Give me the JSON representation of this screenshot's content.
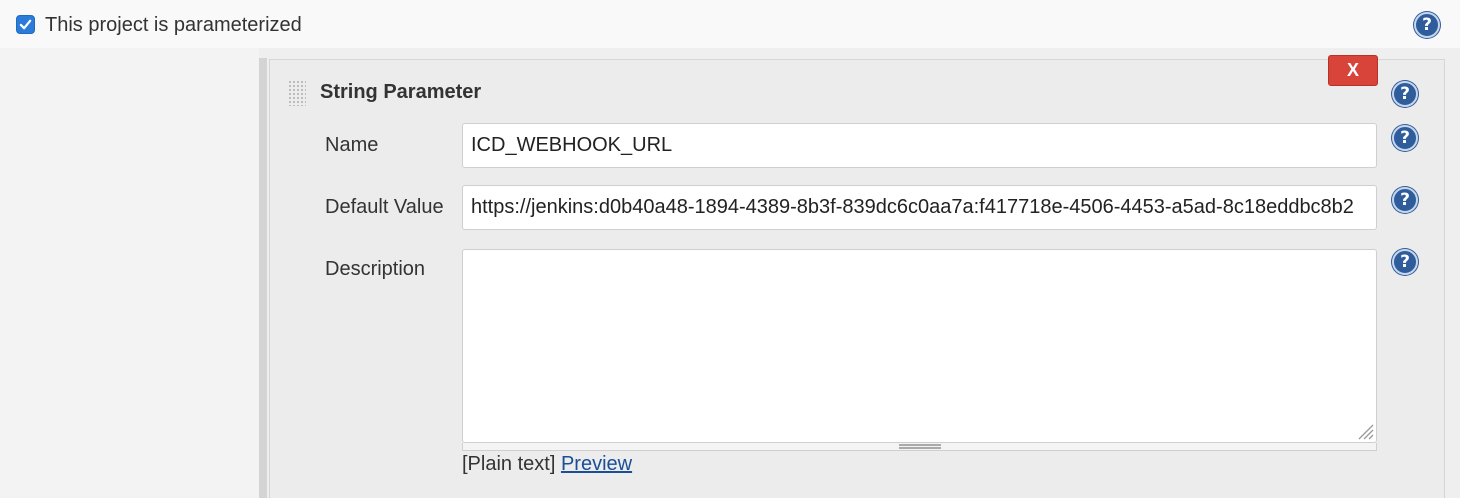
{
  "parameterized": {
    "checked": true,
    "label": "This project is parameterized"
  },
  "parameter": {
    "title": "String Parameter",
    "delete_label": "X",
    "fields": {
      "name": {
        "label": "Name",
        "value": "ICD_WEBHOOK_URL"
      },
      "default_value": {
        "label": "Default Value",
        "value": "https://jenkins:d0b40a48-1894-4389-8b3f-839dc6c0aa7a:f417718e-4506-4453-a5ad-8c18eddbc8b2"
      },
      "description": {
        "label": "Description",
        "value": ""
      }
    },
    "format": {
      "current": "[Plain text]",
      "preview_link": "Preview"
    }
  },
  "icons": {
    "help": "help-icon",
    "checkbox": "check-icon",
    "drag": "drag-handle-icon"
  },
  "colors": {
    "accent": "#2b7bd8",
    "delete": "#d9443a",
    "help": "#2f5d9c",
    "link": "#1a4e97"
  }
}
